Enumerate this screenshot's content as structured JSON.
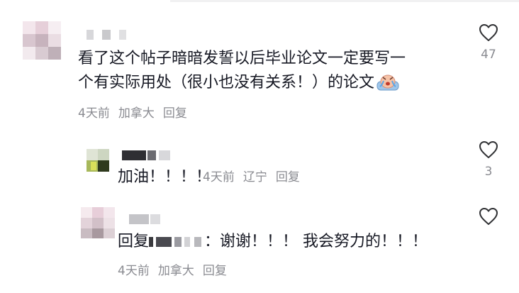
{
  "comments": [
    {
      "text_line1": "看了这个帖子暗暗发誓以后毕业论文一定要写一",
      "text_line2": "个有实际用处（很小也没有关系！）的论文",
      "time": "4天前",
      "location": "加拿大",
      "reply_label": "回复",
      "like_count": "47",
      "emoji": "crying-face-emoji"
    },
    {
      "text": "加油！！！！",
      "time": "4天前",
      "location": "辽宁",
      "reply_label": "回复",
      "like_count": "3"
    },
    {
      "reply_prefix": "回复",
      "text_suffix": "：谢谢！！！ 我会努力的！！！",
      "time": "4天前",
      "location": "加拿大",
      "reply_label": "回复"
    }
  ],
  "colors": {
    "text": "#161823",
    "meta": "#8a8b91",
    "icon": "#2f3033"
  }
}
